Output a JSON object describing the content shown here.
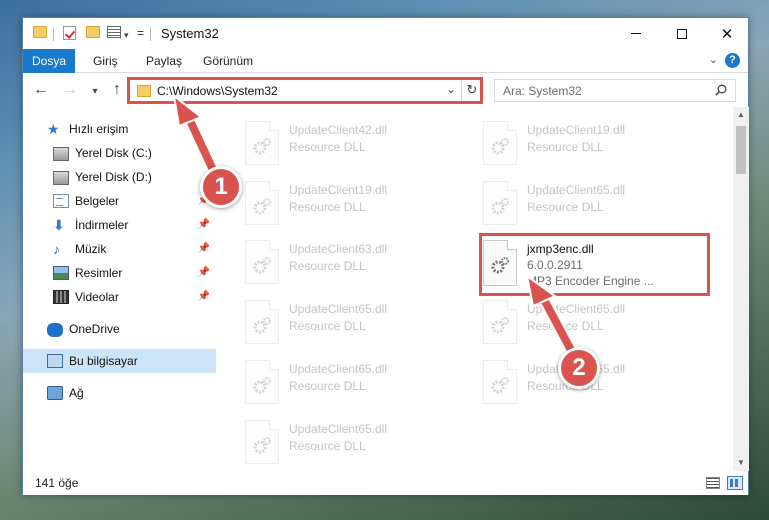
{
  "window": {
    "title": "System32"
  },
  "ribbon": {
    "tabs": [
      "Dosya",
      "Giriş",
      "Paylaş",
      "Görünüm"
    ]
  },
  "navbar": {
    "address": "C:\\Windows\\System32",
    "search_placeholder": "Ara: System32"
  },
  "sidebar": {
    "items": [
      {
        "label": "Hızlı erişim",
        "icon": "star-icon"
      },
      {
        "label": "Yerel Disk (C:)",
        "icon": "disk-icon"
      },
      {
        "label": "Yerel Disk (D:)",
        "icon": "disk-icon"
      },
      {
        "label": "Belgeler",
        "icon": "documents-icon",
        "pinned": true
      },
      {
        "label": "İndirmeler",
        "icon": "download-icon",
        "pinned": true
      },
      {
        "label": "Müzik",
        "icon": "music-icon",
        "pinned": true
      },
      {
        "label": "Resimler",
        "icon": "pictures-icon",
        "pinned": true
      },
      {
        "label": "Videolar",
        "icon": "videos-icon",
        "pinned": true
      },
      {
        "label": "OneDrive",
        "icon": "cloud-icon"
      },
      {
        "label": "Bu bilgisayar",
        "icon": "computer-icon",
        "selected": true
      },
      {
        "label": "Ağ",
        "icon": "network-icon"
      }
    ]
  },
  "files": {
    "faded": [
      {
        "name": "UpdateClient42.dll",
        "type": "Resource DLL"
      },
      {
        "name": "UpdateClient19.dll",
        "type": "Resource DLL"
      },
      {
        "name": "UpdateClient19.dll",
        "type": "Resource DLL"
      },
      {
        "name": "UpdateClient65.dll",
        "type": "Resource DLL"
      },
      {
        "name": "UpdateClient63.dll",
        "type": "Resource DLL"
      },
      {
        "name": "UpdateClient65.dll",
        "type": "Resource DLL"
      },
      {
        "name": "UpdateClient65.dll",
        "type": "Resource DLL"
      },
      {
        "name": "UpdateClient65.dll",
        "type": "Resource DLL"
      },
      {
        "name": "UpdateClient65.dll",
        "type": "Resource DLL"
      },
      {
        "name": "UpdateClient65.dll",
        "type": "Resource DLL"
      }
    ],
    "highlighted": {
      "name": "jxmp3enc.dll",
      "version": "6.0.0.2911",
      "description": "MP3 Encoder Engine ..."
    }
  },
  "status": {
    "count": "141 öğe"
  },
  "annotations": {
    "step1": "1",
    "step2": "2",
    "color": "#d9534f"
  }
}
